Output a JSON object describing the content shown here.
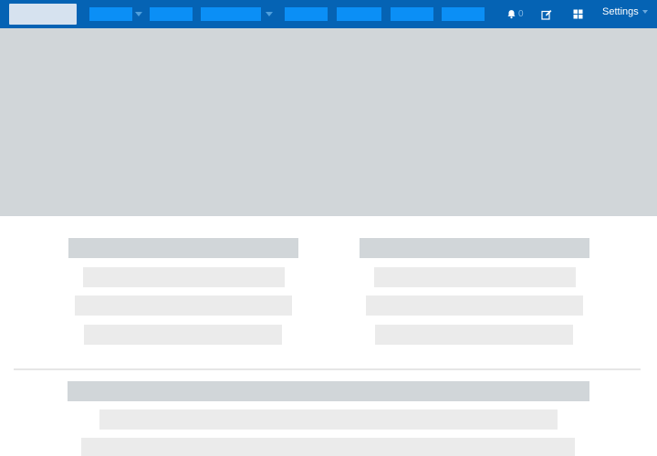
{
  "header": {
    "notifications": {
      "icon": "bell-icon",
      "count": "0"
    },
    "compose": {
      "icon": "edit-icon"
    },
    "apps": {
      "icon": "grid-icon"
    },
    "settings": {
      "label": "Settings"
    }
  },
  "colors": {
    "header_bg": "#0563b4",
    "nav_placeholder": "#0b8ff6",
    "hero_bg": "#d1d6d9",
    "line_placeholder": "#ebebeb"
  }
}
